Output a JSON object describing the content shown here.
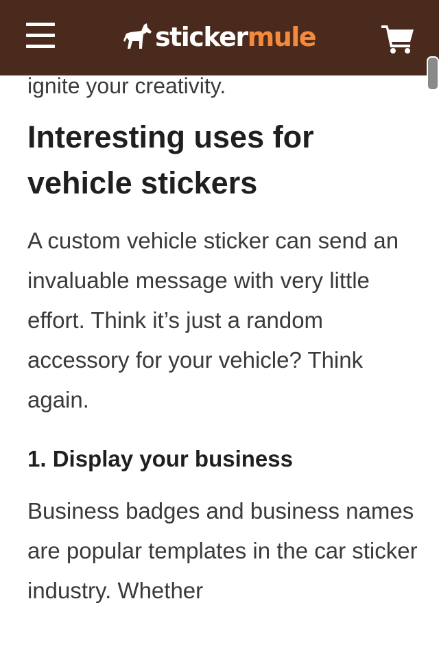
{
  "header": {
    "logo_part1": "sticker",
    "logo_part2": "mule",
    "menu_icon": "hamburger-menu-icon",
    "cart_icon": "shopping-cart-icon",
    "brand_color": "#4a2a1c",
    "accent_color": "#f58a3b"
  },
  "article": {
    "fragment": "ignite your creativity.",
    "heading": "Interesting uses for vehicle stickers",
    "intro": "A custom vehicle sticker can send an invaluable message with very little effort. Think it’s just a random accessory for your vehicle? Think again.",
    "subheading": "1. Display your business",
    "paragraph": "Business badges and business names are popular templates in the car sticker industry. Whether"
  }
}
